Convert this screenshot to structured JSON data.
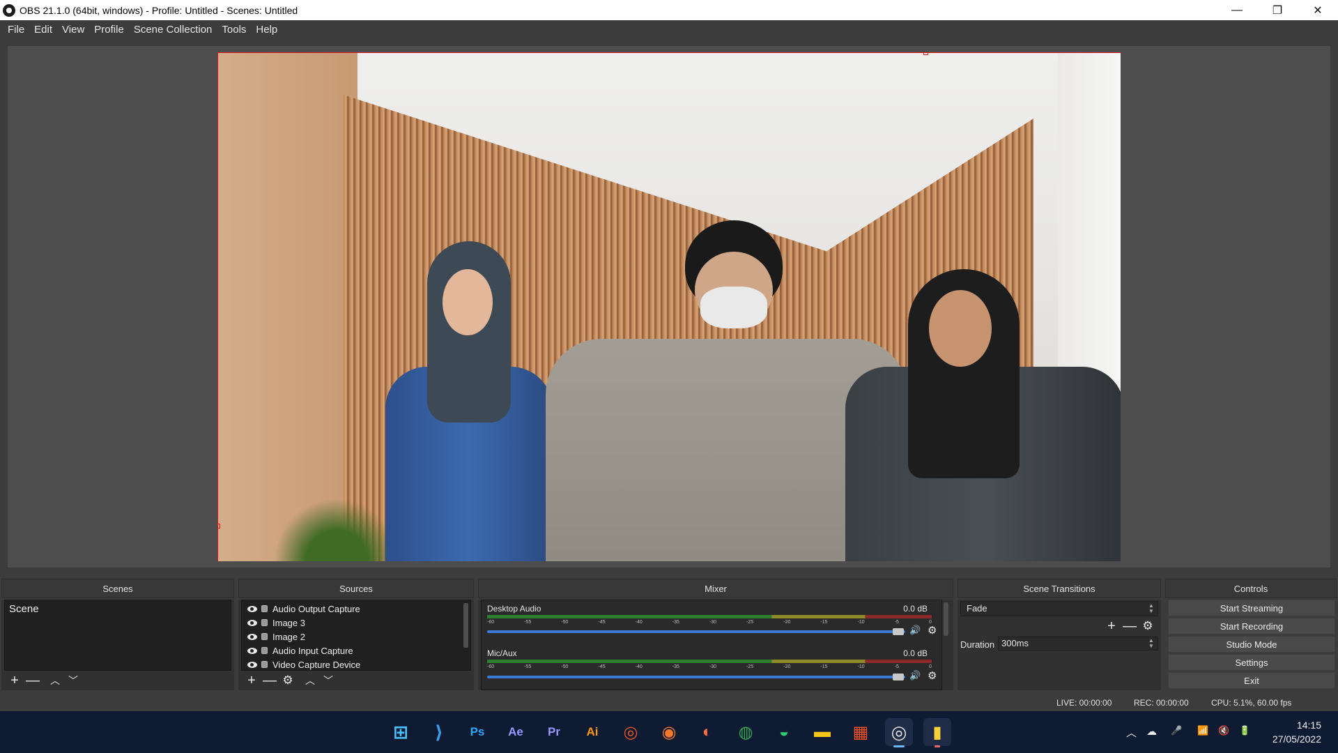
{
  "window": {
    "title": "OBS 21.1.0 (64bit, windows) - Profile: Untitled - Scenes: Untitled",
    "minimize": "—",
    "restore": "❐",
    "close": "✕"
  },
  "menu": [
    "File",
    "Edit",
    "View",
    "Profile",
    "Scene Collection",
    "Tools",
    "Help"
  ],
  "docks": {
    "scenes": "Scenes",
    "sources": "Sources",
    "mixer": "Mixer",
    "transitions": "Scene Transitions",
    "controls": "Controls"
  },
  "scenes": {
    "items": [
      "Scene"
    ]
  },
  "sources": {
    "items": [
      "Audio Output Capture",
      "Image 3",
      "Image 2",
      "Audio Input Capture",
      "Video Capture Device"
    ]
  },
  "toolbar": {
    "add": "+",
    "remove": "—",
    "gear": "⚙",
    "up": "︿",
    "down": "﹀"
  },
  "mixer": {
    "ticks": [
      "-60",
      "-55",
      "-50",
      "-45",
      "-40",
      "-35",
      "-30",
      "-25",
      "-20",
      "-15",
      "-10",
      "-5",
      "0"
    ],
    "channels": [
      {
        "name": "Desktop Audio",
        "db": "0.0 dB",
        "volume": 0.99
      },
      {
        "name": "Mic/Aux",
        "db": "0.0 dB",
        "volume": 0.99
      }
    ],
    "speaker_icon": "🔊",
    "gear_icon": "⚙"
  },
  "transitions": {
    "selected": "Fade",
    "duration_label": "Duration",
    "duration_value": "300ms"
  },
  "controls": [
    "Start Streaming",
    "Start Recording",
    "Studio Mode",
    "Settings",
    "Exit"
  ],
  "status": {
    "live": "LIVE: 00:00:00",
    "rec": "REC: 00:00:00",
    "cpu": "CPU: 5.1%, 60.00 fps"
  },
  "taskbar": {
    "apps": [
      {
        "name": "windows-start",
        "label": "⊞",
        "color": "#4cc2ff"
      },
      {
        "name": "vscode",
        "label": "⟩",
        "color": "#3aa0f0"
      },
      {
        "name": "photoshop",
        "label": "Ps",
        "color": "#31a8ff"
      },
      {
        "name": "after-effects",
        "label": "Ae",
        "color": "#9999ff"
      },
      {
        "name": "premiere",
        "label": "Pr",
        "color": "#9999ff"
      },
      {
        "name": "illustrator",
        "label": "Ai",
        "color": "#ff9a00"
      },
      {
        "name": "ubuntu",
        "label": "◎",
        "color": "#e95420"
      },
      {
        "name": "blender",
        "label": "◉",
        "color": "#f5792a"
      },
      {
        "name": "firefox",
        "label": "◐",
        "color": "#ff7139"
      },
      {
        "name": "chrome",
        "label": "◍",
        "color": "#34a853"
      },
      {
        "name": "edge",
        "label": "◒",
        "color": "#2ecc71"
      },
      {
        "name": "file-explorer",
        "label": "▬",
        "color": "#f5c518"
      },
      {
        "name": "ms-store",
        "label": "▦",
        "color": "#f35325"
      },
      {
        "name": "obs",
        "label": "◎",
        "color": "#e8e8e8"
      },
      {
        "name": "sticky",
        "label": "▮",
        "color": "#f7d13c"
      }
    ],
    "tray": [
      "︿",
      "☁",
      "🎤",
      "📶",
      "🔇",
      "🔋"
    ],
    "time": "14:15",
    "date": "27/05/2022"
  }
}
